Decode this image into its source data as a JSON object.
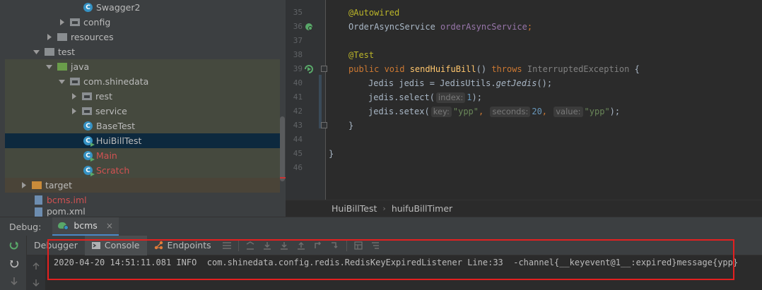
{
  "project_tree": {
    "items": [
      {
        "label": "Swagger2",
        "kind": "class"
      },
      {
        "label": "config",
        "kind": "package"
      },
      {
        "label": "resources",
        "kind": "folder"
      },
      {
        "label": "test",
        "kind": "folder"
      },
      {
        "label": "java",
        "kind": "folder"
      },
      {
        "label": "com.shinedata",
        "kind": "package"
      },
      {
        "label": "rest",
        "kind": "package"
      },
      {
        "label": "service",
        "kind": "package"
      },
      {
        "label": "BaseTest",
        "kind": "class"
      },
      {
        "label": "HuiBillTest",
        "kind": "class",
        "selected": true
      },
      {
        "label": "Main",
        "kind": "class"
      },
      {
        "label": "Scratch",
        "kind": "class"
      },
      {
        "label": "target",
        "kind": "folder"
      },
      {
        "label": "bcms.iml",
        "kind": "file"
      },
      {
        "label": "pom.xml",
        "kind": "file"
      }
    ]
  },
  "editor": {
    "line_numbers": [
      "35",
      "36",
      "37",
      "38",
      "39",
      "40",
      "41",
      "42",
      "43",
      "44",
      "45",
      "46"
    ],
    "lines": {
      "l35_annotation": "@Autowired",
      "l36_type": "OrderAsyncService ",
      "l36_field": "orderAsyncService",
      "l36_semi": ";",
      "l38_annotation": "@Test",
      "l39_public": "public ",
      "l39_void": "void ",
      "l39_method": "sendHuifuBill",
      "l39_parens": "() ",
      "l39_throws": "throws ",
      "l39_exception": "InterruptedException",
      "l39_brace": " {",
      "l40_text": "Jedis jedis = JedisUtils.",
      "l40_method": "getJedis",
      "l40_end": "();",
      "l41_text": "jedis.select(",
      "l41_hint": "index:",
      "l41_value": "1",
      "l41_end": ");",
      "l42_text": "jedis.setex(",
      "l42_hint1": "key:",
      "l42_str1": "\"ypp\"",
      "l42_comma": ", ",
      "l42_hint2": "seconds:",
      "l42_num": "20",
      "l42_hint3": "value:",
      "l42_str2": "\"ypp\"",
      "l42_end": ");",
      "l43_text": "}",
      "l45_text": "}"
    },
    "breadcrumb": [
      "HuiBillTest",
      "huifuBillTimer"
    ]
  },
  "debug": {
    "title": "Debug:",
    "session_tab": "bcms",
    "close_glyph": "×",
    "tabs": {
      "debugger": "Debugger",
      "console": "Console",
      "endpoints": "Endpoints"
    },
    "console_line": "2020-04-20 14:51:11.081 INFO  com.shinedata.config.redis.RedisKeyExpiredListener Line:33  -channel{__keyevent@1__:expired}message{ypp}"
  },
  "colors": {
    "annotation": "#bbb529",
    "keyword": "#cc7832",
    "method": "#ffc66d",
    "field": "#9876aa",
    "string": "#6a8759",
    "number": "#6897bb",
    "selection": "#0d293e",
    "highlight_box": "#e32020"
  }
}
